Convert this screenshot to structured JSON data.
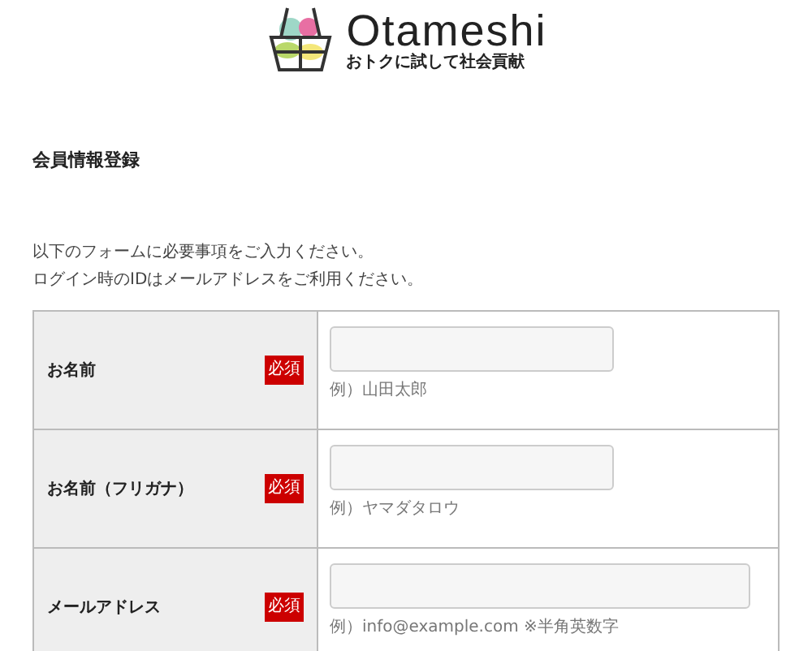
{
  "logo": {
    "name": "Otameshi",
    "tagline": "おトクに試して社会貢献"
  },
  "heading": "会員情報登録",
  "intro": [
    "以下のフォームに必要事項をご入力ください。",
    "ログイン時のIDはメールアドレスをご利用ください。"
  ],
  "fields": [
    {
      "label": "お名前",
      "required": true,
      "badge": "必須",
      "kind": "text",
      "hint": "例）山田太郎"
    },
    {
      "label": "お名前（フリガナ）",
      "required": true,
      "badge": "必須",
      "kind": "text",
      "hint": "例）ヤマダタロウ"
    },
    {
      "label": "メールアドレス",
      "required": true,
      "badge": "必須",
      "kind": "email",
      "hint": "例）info@example.com ※半角英数字"
    }
  ]
}
